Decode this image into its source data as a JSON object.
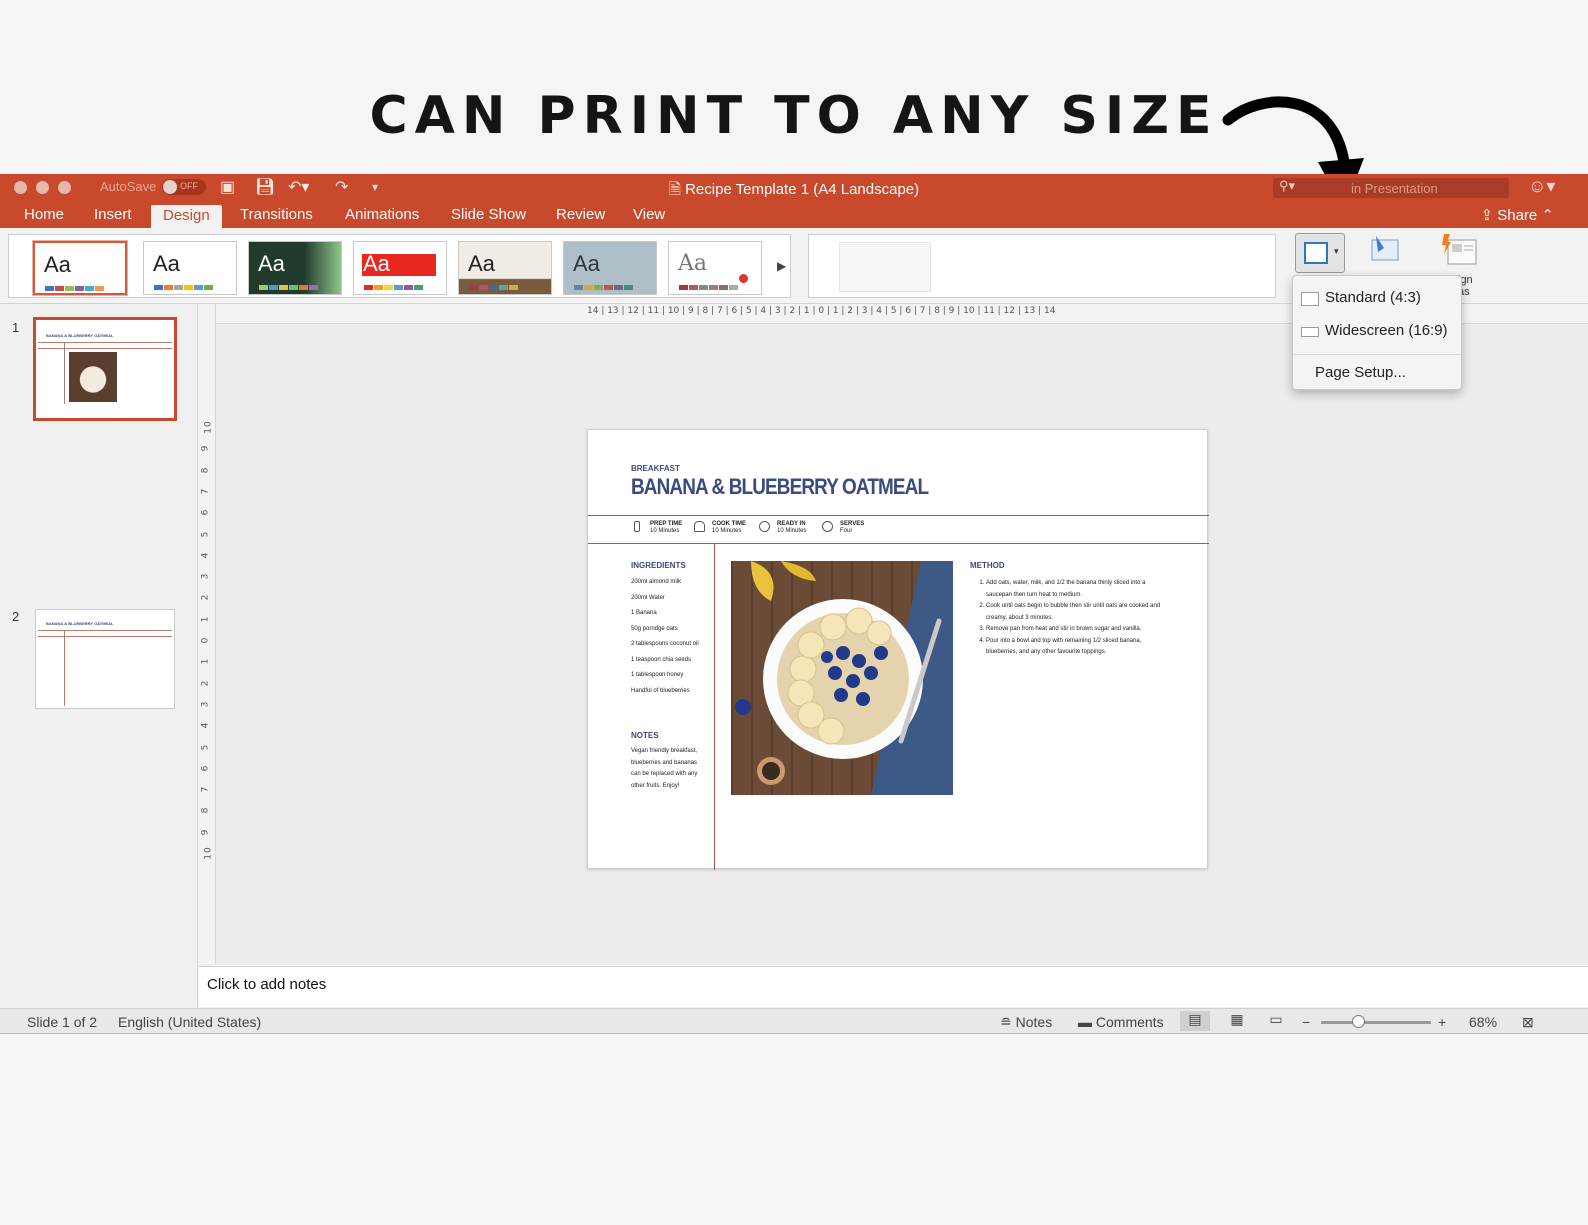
{
  "headline": "CAN PRINT TO ANY SIZE",
  "window": {
    "title": "Recipe Template 1 (A4 Landscape)",
    "autosave_label": "AutoSave",
    "autosave_state": "OFF",
    "search_placeholder": "in Presentation"
  },
  "tabs": [
    "Home",
    "Insert",
    "Design",
    "Transitions",
    "Animations",
    "Slide Show",
    "Review",
    "View"
  ],
  "active_tab": "Design",
  "share_label": "Share",
  "themes": [
    {
      "label": "Aa",
      "selected": true
    },
    {
      "label": "Aa"
    },
    {
      "label": "Aa"
    },
    {
      "label": "Aa"
    },
    {
      "label": "Aa"
    },
    {
      "label": "Aa"
    },
    {
      "label": "Aa"
    }
  ],
  "design_ideas_label": "ign\nas",
  "slide_size_menu": {
    "items": [
      "Standard (4:3)",
      "Widescreen (16:9)"
    ],
    "page_setup": "Page Setup..."
  },
  "thumbnails": [
    {
      "num": "1",
      "title": "BANANA & BLUEBERRY OATMEAL"
    },
    {
      "num": "2",
      "title": "BANANA & BLUEBERRY OATMEAL"
    }
  ],
  "ruler": {
    "h": "14 | 13 | 12 | 11 | 10 | 9 | 8 | 7 | 6 | 5 | 4 | 3 | 2 | 1 | 0 | 1 | 2 | 3 | 4 | 5 | 6 | 7 | 8 | 9 | 10 | 11 | 12 | 13 | 14",
    "v": [
      "10",
      "9",
      "8",
      "7",
      "6",
      "5",
      "4",
      "3",
      "2",
      "1",
      "0",
      "1",
      "2",
      "3",
      "4",
      "5",
      "6",
      "7",
      "8",
      "9",
      "10"
    ]
  },
  "slide": {
    "category": "BREAKFAST",
    "title": "BANANA & BLUEBERRY OATMEAL",
    "meta": [
      {
        "label": "PREP TIME",
        "value": "10 Minutes"
      },
      {
        "label": "COOK TIME",
        "value": "10 Minutes"
      },
      {
        "label": "READY IN",
        "value": "10 Minutes"
      },
      {
        "label": "SERVES",
        "value": "Four"
      }
    ],
    "ingredients_heading": "INGREDIENTS",
    "ingredients": [
      "200ml almond milk",
      "200ml Water",
      "1 Banana",
      "50g porridge oats",
      "2 tablespoons coconut oil",
      "1 teaspoon chia seeds",
      "1 tablespoon honey",
      "Handful of blueberries"
    ],
    "notes_heading": "NOTES",
    "notes": "Vegan friendly breakfast, blueberries and bananas can be replaced with any other fruits. Enjoy!",
    "method_heading": "METHOD",
    "method": [
      "Add oats, water, milk, and 1/2 the banana thinly sliced into a saucepan then turn heat to medium.",
      "Cook until oats begin to bubble then stir until oats are cooked and creamy, about 3 minutes.",
      "Remove pan from heat and stir in brown sugar and vanilla.",
      "Pour into a bowl and top with remaining 1/2 sliced banana, blueberries, and any other favourite toppings."
    ]
  },
  "notes_placeholder": "Click to add notes",
  "status": {
    "slide_count": "Slide 1 of 2",
    "language": "English (United States)",
    "notes": "Notes",
    "comments": "Comments",
    "zoom": "68%"
  },
  "colors": {
    "accent": "#c8492c",
    "slide_title": "#3b4a80",
    "rule": "#a0594b"
  }
}
